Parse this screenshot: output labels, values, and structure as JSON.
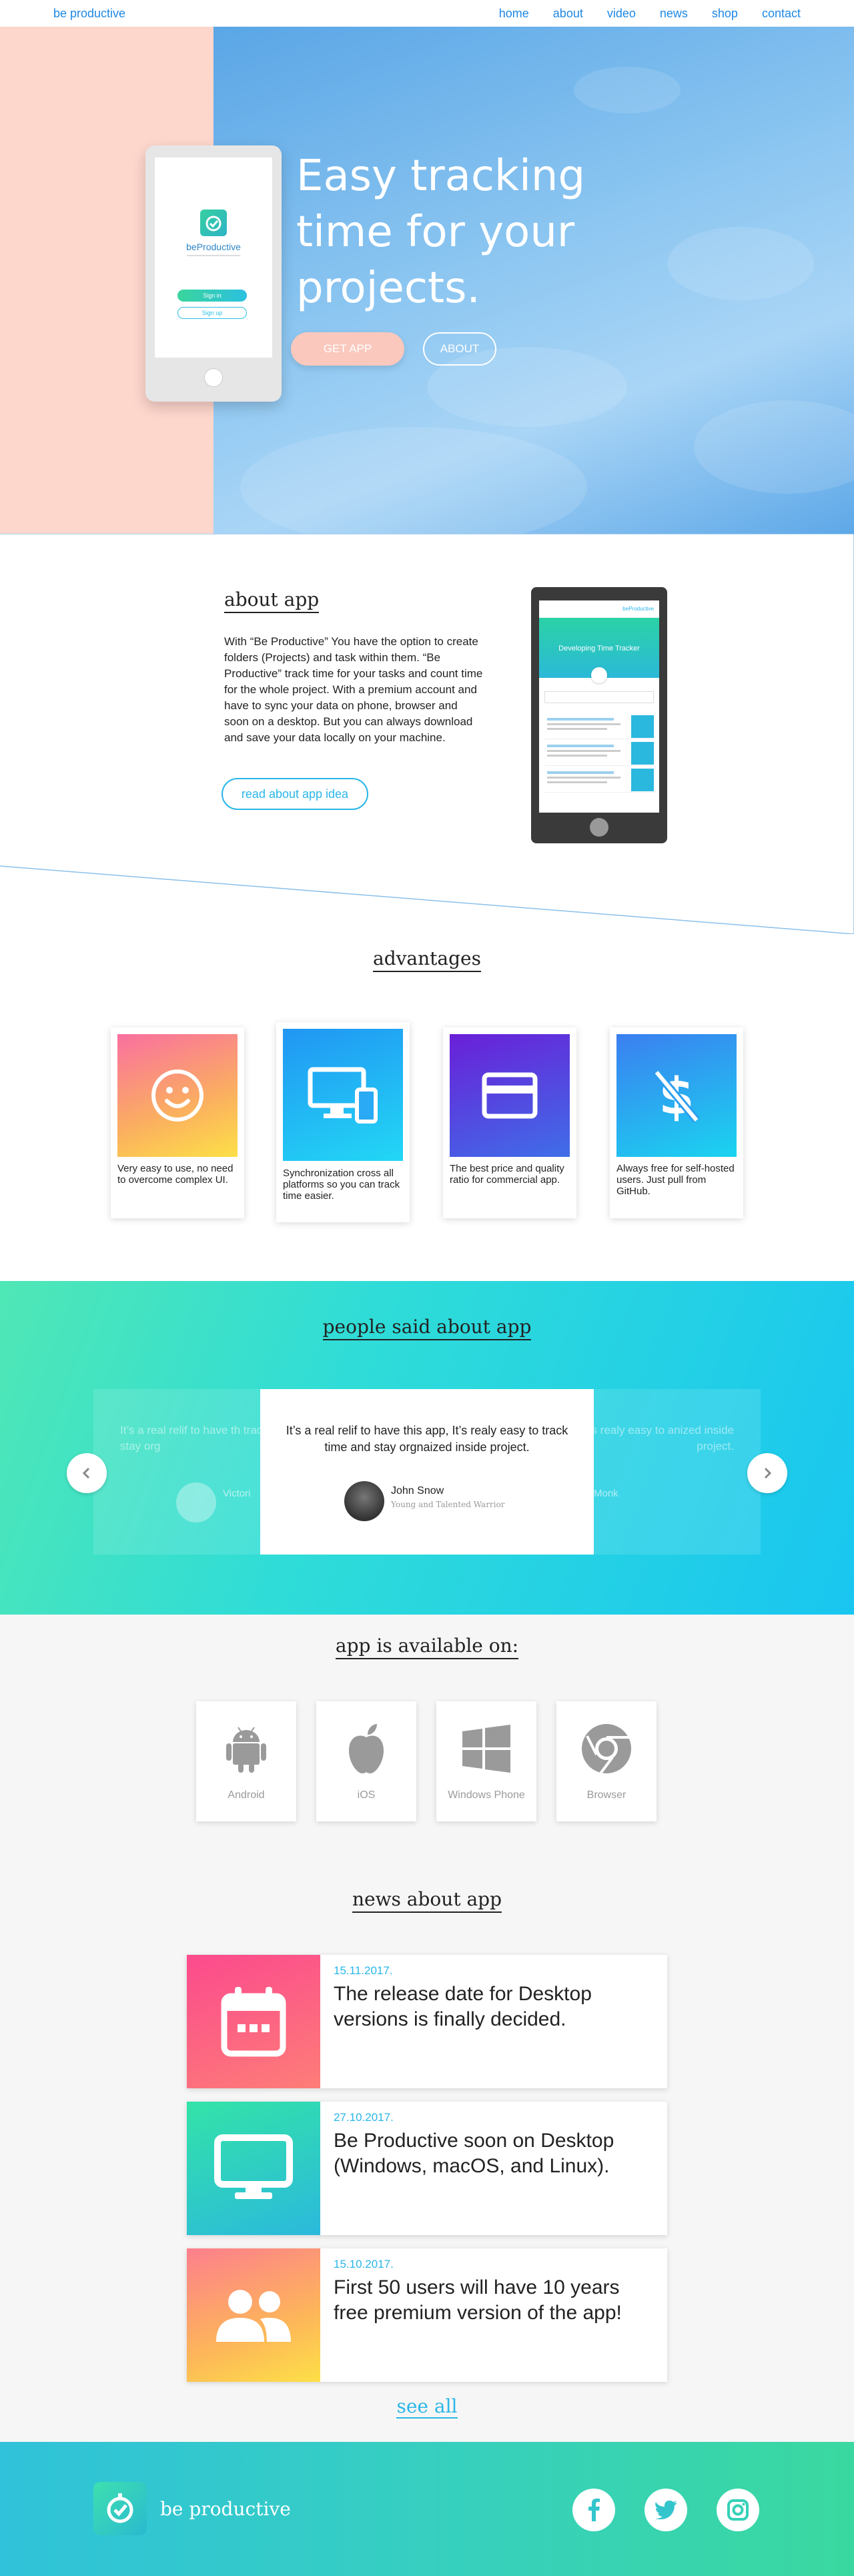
{
  "nav": {
    "brand": "be productive",
    "links": [
      "home",
      "about",
      "video",
      "news",
      "shop",
      "contact"
    ]
  },
  "hero": {
    "headline": "Easy tracking time for your projects.",
    "get_app": "GET APP",
    "about": "ABOUT",
    "phone_app_name": "beProductive",
    "phone_sign_in": "Sign in",
    "phone_sign_up": "Sign up"
  },
  "about": {
    "title": "about app",
    "body": "With “Be Productive” You have the option to create folders (Projects) and task within them. “Be Productive” track time for your tasks and count time for the whole project. With a premium account and have to sync your data on phone, browser and soon on a desktop. But you can always download and save your data locally on your machine.",
    "read_more": "read about app idea",
    "phone_title": "Developing Time Tracker",
    "phone_brand": "beProductive"
  },
  "advantages": {
    "title": "advantages",
    "items": [
      {
        "icon": "smile-icon",
        "text": "Very easy to use, no need to overcome complex UI."
      },
      {
        "icon": "devices-icon",
        "text": "Synchronization cross all platforms so you can track time easier."
      },
      {
        "icon": "credit-card-icon",
        "text": "The best price and quality ratio for commercial app."
      },
      {
        "icon": "no-money-icon",
        "text": "Always free for self-hosted users. Just pull from GitHub."
      }
    ]
  },
  "testimonials": {
    "title": "people said about app",
    "quote": "It’s a real relif to have this app, It’s realy easy to track time and stay orgnaized inside project.",
    "name": "John Snow",
    "role": "Young and Talented Warrior",
    "left_quote": "It’s a real relif to have th track time and stay org",
    "left_name": "Victori",
    "right_quote": "s app, It’s realy easy to anized inside project.",
    "right_name": "Monk"
  },
  "available": {
    "title": "app is available on:",
    "platforms": [
      "Android",
      "iOS",
      "Windows Phone",
      "Browser"
    ]
  },
  "news": {
    "title": "news about app",
    "items": [
      {
        "date": "15.11.2017.",
        "title": "The release date for Desktop versions is finally decided.",
        "icon": "calendar-icon"
      },
      {
        "date": "27.10.2017.",
        "title": "Be Productive soon on Desktop (Windows, macOS, and Linux).",
        "icon": "monitor-icon"
      },
      {
        "date": "15.10.2017.",
        "title": "First 50 users will have 10 years free premium version of the app!",
        "icon": "users-icon"
      }
    ],
    "see_all": "see all"
  },
  "footer": {
    "brand": "be productive",
    "social": [
      "facebook-icon",
      "twitter-icon",
      "instagram-icon"
    ]
  }
}
